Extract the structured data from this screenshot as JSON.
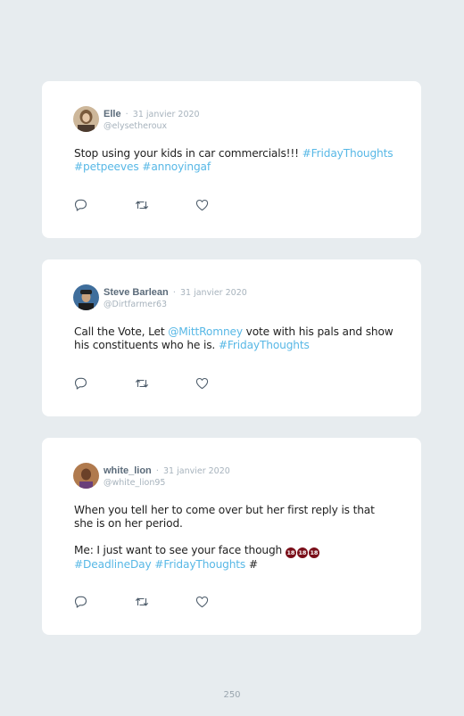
{
  "tweets": [
    {
      "name": "Elle",
      "separator": "·",
      "date": "31 janvier 2020",
      "handle": "@elysetheroux",
      "paragraphs": [
        [
          {
            "text": "Stop using your kids in car commercials!!! ",
            "type": "text"
          },
          {
            "text": "#FridayThoughts",
            "type": "link"
          },
          {
            "text": " ",
            "type": "text"
          },
          {
            "text": "#petpeeves",
            "type": "link"
          },
          {
            "text": " ",
            "type": "text"
          },
          {
            "text": "#annoyingaf",
            "type": "link"
          }
        ]
      ]
    },
    {
      "name": "Steve Barlean",
      "separator": "·",
      "date": "31 janvier 2020",
      "handle": "@Dirtfarmer63",
      "paragraphs": [
        [
          {
            "text": "Call the  Vote, Let ",
            "type": "text"
          },
          {
            "text": "@MittRomney",
            "type": "link"
          },
          {
            "text": " vote with his pals and show his constituents who he is. ",
            "type": "text"
          },
          {
            "text": "#FridayThoughts",
            "type": "link"
          }
        ]
      ]
    },
    {
      "name": "white_lion",
      "separator": "·",
      "date": "31 janvier 2020",
      "handle": "@white_lion95",
      "paragraphs": [
        [
          {
            "text": "When you tell her to come over but her first reply is that she is on her period.",
            "type": "text"
          }
        ],
        [
          {
            "text": "Me: I just want to see your face though ",
            "type": "text"
          },
          {
            "text": "🔞🔞🔞",
            "type": "emoji",
            "icon": "no-one-under-eighteen-icon"
          },
          {
            "text": "\n",
            "type": "break"
          },
          {
            "text": "#DeadlineDay",
            "type": "link"
          },
          {
            "text": " ",
            "type": "text"
          },
          {
            "text": "#FridayThoughts",
            "type": "link"
          },
          {
            "text": " #",
            "type": "text"
          }
        ]
      ]
    }
  ],
  "actions": [
    "reply-icon",
    "retweet-icon",
    "like-icon"
  ],
  "page_number": "250",
  "colors": {
    "background": "#e7ecef",
    "card": "#ffffff",
    "link": "#58b8e6",
    "name": "#5b6b7a",
    "muted": "#a7b3bd"
  }
}
